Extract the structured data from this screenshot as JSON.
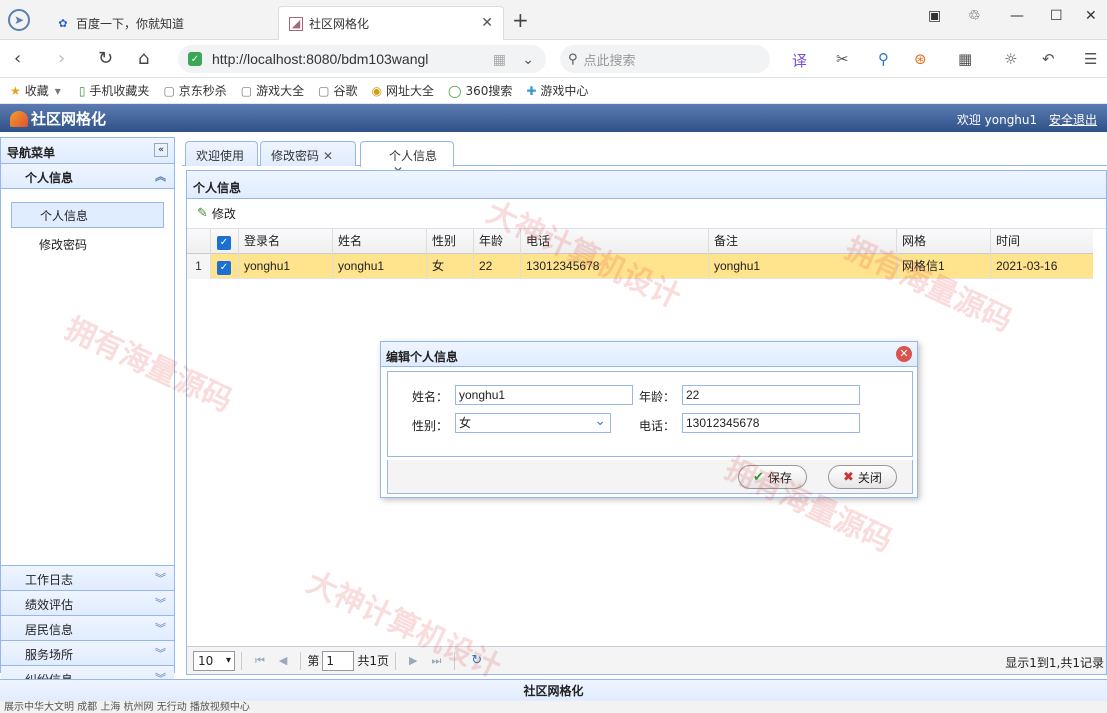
{
  "browser": {
    "tabs": [
      {
        "title": "百度一下，你就知道"
      },
      {
        "title": "社区网格化"
      }
    ],
    "url": "http://localhost:8080/bdm103wangl",
    "search_placeholder": "点此搜索",
    "favorites": [
      "收藏",
      "手机收藏夹",
      "京东秒杀",
      "游戏大全",
      "谷歌",
      "网址大全",
      "360搜索",
      "游戏中心"
    ]
  },
  "app": {
    "title": "社区网格化",
    "welcome": "欢迎 yonghu1",
    "logout": "安全退出",
    "footer": "社区网格化"
  },
  "sidebar": {
    "title": "导航菜单",
    "active_section": "个人信息",
    "items": [
      "个人信息",
      "修改密码"
    ],
    "sections": [
      "工作日志",
      "绩效评估",
      "居民信息",
      "服务场所",
      "纠纷信息"
    ]
  },
  "page_tabs": [
    {
      "label": "欢迎使用"
    },
    {
      "label": "修改密码"
    },
    {
      "label": "个人信息"
    }
  ],
  "panel": {
    "title": "个人信息",
    "edit_label": "修改"
  },
  "grid": {
    "columns": [
      "登录名",
      "姓名",
      "性别",
      "年龄",
      "电话",
      "备注",
      "网格",
      "时间"
    ],
    "rows": [
      {
        "num": "1",
        "cells": [
          "yonghu1",
          "yonghu1",
          "女",
          "22",
          "13012345678",
          "yonghu1",
          "网格信1",
          "2021-03-16"
        ]
      }
    ]
  },
  "pager": {
    "page_size": "10",
    "page_prefix": "第",
    "page": "1",
    "page_total": "共1页",
    "info": "显示1到1,共1记录"
  },
  "dialog": {
    "title": "编辑个人信息",
    "name_label": "姓名：",
    "name_value": "yonghu1",
    "age_label": "年龄：",
    "age_value": "22",
    "gender_label": "性别：",
    "gender_value": "女",
    "phone_label": "电话：",
    "phone_value": "13012345678",
    "save": "保存",
    "close": "关闭"
  },
  "statusbar": "展示中华大文明 成都 上海 杭州网 无行动 播放视频中心"
}
